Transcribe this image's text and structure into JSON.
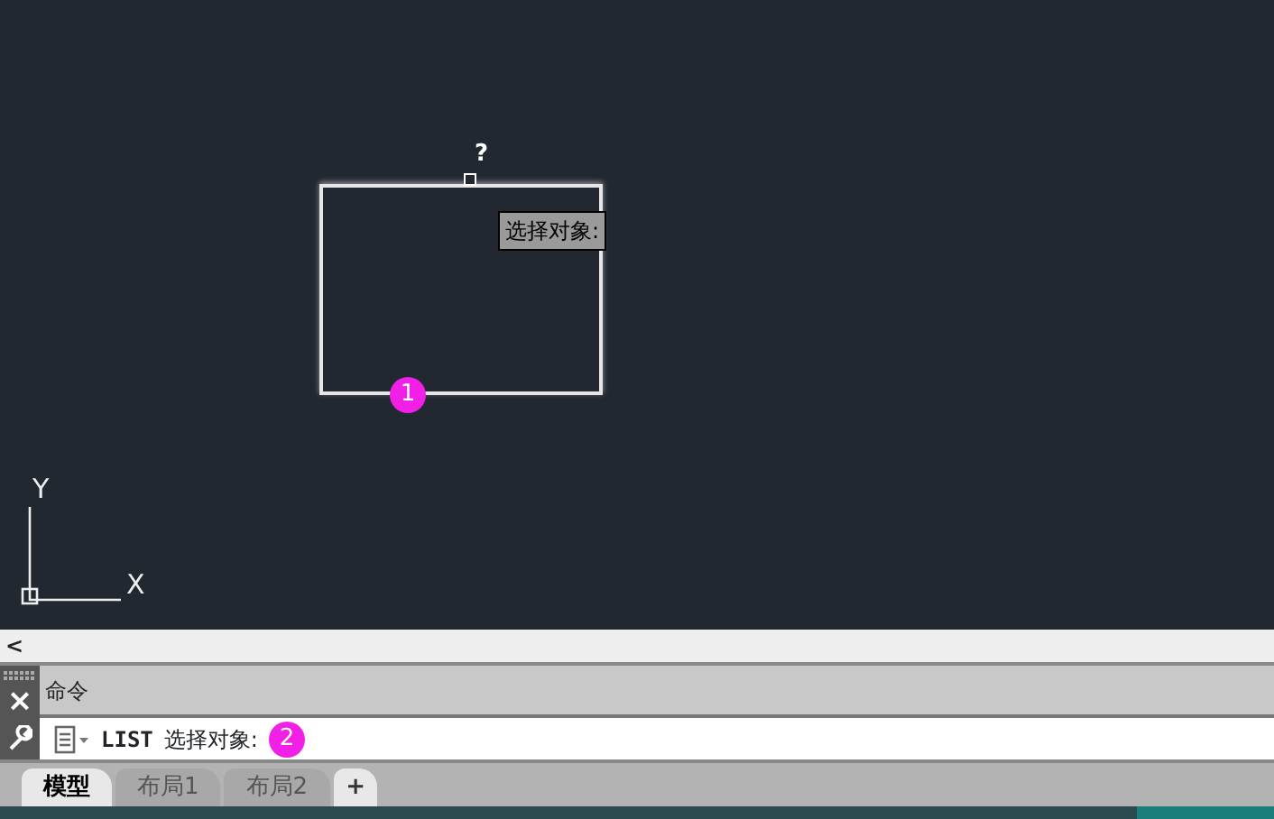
{
  "drawing": {
    "cursor_mark": "?",
    "tooltip": "选择对象:",
    "marker": "1",
    "axes": {
      "y": "Y",
      "x": "X"
    }
  },
  "panel": {
    "collapse": "<",
    "close": "×",
    "title": "命令",
    "command": "LIST",
    "prompt": "选择对象:",
    "marker": "2"
  },
  "tabs": [
    {
      "label": "模型",
      "selected": true
    },
    {
      "label": "布局1",
      "selected": false
    },
    {
      "label": "布局2",
      "selected": false
    }
  ],
  "add_tab": "+"
}
